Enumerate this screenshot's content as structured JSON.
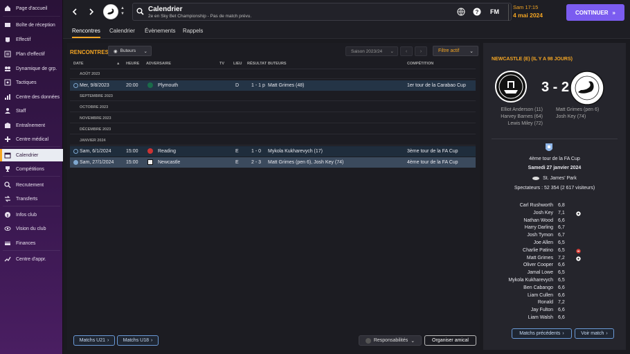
{
  "sidebar": {
    "items": [
      {
        "label": "Page d'accueil",
        "icon": "home-icon"
      },
      {
        "label": "Boîte de réception",
        "icon": "inbox-icon"
      },
      {
        "label": "Effectif",
        "icon": "squad-icon"
      },
      {
        "label": "Plan d'effectif",
        "icon": "plan-icon"
      },
      {
        "label": "Dynamique de grp.",
        "icon": "group-dynamics-icon"
      },
      {
        "label": "Tactiques",
        "icon": "tactics-icon"
      },
      {
        "label": "Centre des données",
        "icon": "data-hub-icon"
      },
      {
        "label": "Staff",
        "icon": "staff-icon"
      },
      {
        "label": "Entraînement",
        "icon": "training-icon"
      },
      {
        "label": "Centre médical",
        "icon": "medical-icon"
      },
      {
        "label": "Calendrier",
        "icon": "calendar-icon",
        "active": true
      },
      {
        "label": "Compétitions",
        "icon": "trophy-icon"
      },
      {
        "label": "Recrutement",
        "icon": "scouting-icon"
      },
      {
        "label": "Transferts",
        "icon": "transfers-icon"
      },
      {
        "label": "Infos club",
        "icon": "club-info-icon"
      },
      {
        "label": "Vision du club",
        "icon": "club-vision-icon"
      },
      {
        "label": "Finances",
        "icon": "finances-icon"
      },
      {
        "label": "Centre d'appr.",
        "icon": "dev-centre-icon"
      }
    ]
  },
  "header": {
    "title": "Calendrier",
    "subtitle": "2e en Sky Bet Championship - Pas de match prévu.",
    "fm_label": "FM",
    "time": "Sam 17:15",
    "date": "4 mai 2024",
    "continue_label": "CONTINUER"
  },
  "tabs": [
    {
      "label": "Rencontres",
      "active": true
    },
    {
      "label": "Calendrier"
    },
    {
      "label": "Évènements"
    },
    {
      "label": "Rappels"
    }
  ],
  "main": {
    "section_title": "RENCONTRES",
    "buteurs_label": "Buteurs",
    "season_label": "Saison 2023/24",
    "filter_label": "Filtre actif",
    "columns": {
      "date": "DATE",
      "heure": "HEURE",
      "adversaire": "ADVERSAIRE",
      "tv": "TV",
      "lieu": "LIEU",
      "resultat": "RÉSULTAT",
      "buteurs": "BUTEURS",
      "competition": "COMPÉTITION"
    },
    "months": [
      "AOÛT 2023",
      "SEPTEMBRE 2023",
      "OCTOBRE 2023",
      "NOVEMBRE 2023",
      "DÉCEMBRE 2023",
      "JANVIER 2024"
    ],
    "matches": [
      {
        "date": "Mer, 9/8/2023",
        "time": "20:00",
        "opponent": "Plymouth",
        "venue": "D",
        "result": "1 - 1 p",
        "scorers": "Matt Grimes (48)",
        "competition": "1er tour de la Carabao Cup"
      },
      {
        "date": "Sam, 6/1/2024",
        "time": "15:00",
        "opponent": "Reading",
        "venue": "E",
        "result": "1 - 0",
        "scorers": "Mykola Kukharevych (17)",
        "competition": "3ème tour de la FA Cup"
      },
      {
        "date": "Sam, 27/1/2024",
        "time": "15:00",
        "opponent": "Newcastle",
        "venue": "E",
        "result": "2 - 3",
        "scorers": "Matt Grimes (pen 6), Josh Key (74)",
        "competition": "4ème tour de la FA Cup"
      }
    ],
    "btn_u21": "Matchs U21",
    "btn_u18": "Matchs U18",
    "btn_resp": "Responsabilités",
    "btn_friendly": "Organiser amical"
  },
  "panel": {
    "title": "NEWCASTLE (E) (IL Y A 98 JOURS)",
    "score": "3 - 2",
    "home_scorers": [
      "Elliot Anderson (11)",
      "Harvey Barnes (64)",
      "Lewis Miley (72)"
    ],
    "away_scorers": [
      "Matt Grimes (pen 6)",
      "Josh Key (74)"
    ],
    "competition": "4ème tour de la FA Cup",
    "date": "Samedi 27 janvier 2024",
    "stadium": "St. James' Park",
    "attendance": "Spectateurs : 52 354 (2 617 visiteurs)",
    "players": [
      {
        "name": "Carl Rushworth",
        "rating": "6,8",
        "event": ""
      },
      {
        "name": "Josh Key",
        "rating": "7,1",
        "event": "goal"
      },
      {
        "name": "Nathan Wood",
        "rating": "6,6",
        "event": ""
      },
      {
        "name": "Harry Darling",
        "rating": "6,7",
        "event": ""
      },
      {
        "name": "Josh Tymon",
        "rating": "6,7",
        "event": ""
      },
      {
        "name": "Joe Allen",
        "rating": "6,5",
        "event": ""
      },
      {
        "name": "Charlie Patino",
        "rating": "6,5",
        "event": "sub"
      },
      {
        "name": "Matt Grimes",
        "rating": "7,2",
        "event": "goal"
      },
      {
        "name": "Oliver Cooper",
        "rating": "6,6",
        "event": ""
      },
      {
        "name": "Jamal Lowe",
        "rating": "6,5",
        "event": ""
      },
      {
        "name": "Mykola Kukharevych",
        "rating": "6,5",
        "event": ""
      },
      {
        "name": "Ben Cabango",
        "rating": "6,6",
        "event": ""
      },
      {
        "name": "Liam Cullen",
        "rating": "6,6",
        "event": ""
      },
      {
        "name": "Ronald",
        "rating": "7,2",
        "event": ""
      },
      {
        "name": "Jay Fulton",
        "rating": "6,6",
        "event": ""
      },
      {
        "name": "Liam Walsh",
        "rating": "6,6",
        "event": ""
      }
    ],
    "btn_prev": "Matchs précédents",
    "btn_view": "Voir match"
  },
  "colors": {
    "accent": "#f5a623",
    "continue": "#7b5cf0",
    "sidebar": "#3a1850"
  }
}
